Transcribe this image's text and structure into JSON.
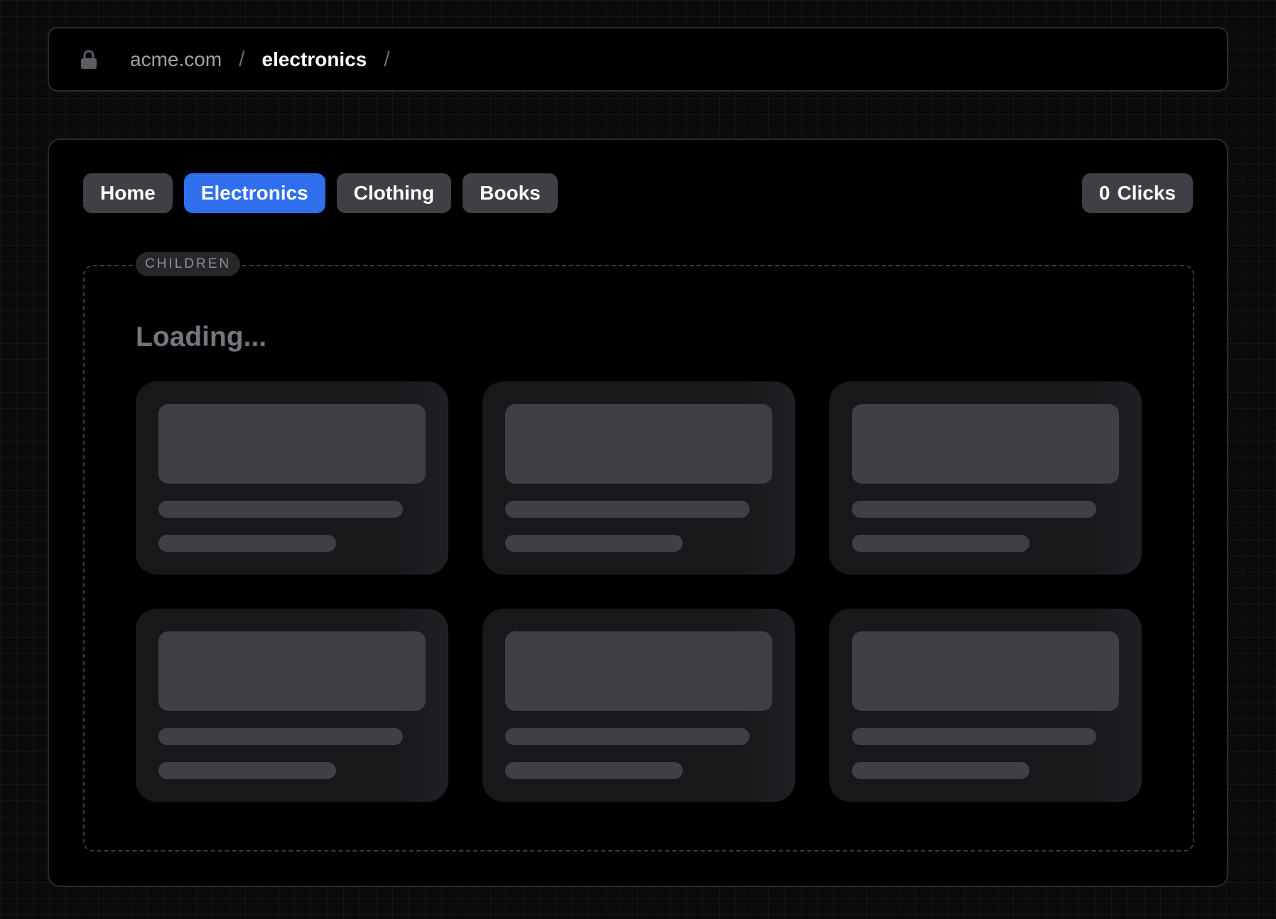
{
  "address_bar": {
    "icon": "lock-icon",
    "domain": "acme.com",
    "separator": "/",
    "segment": "electronics"
  },
  "nav": {
    "items": [
      {
        "label": "Home",
        "active": false
      },
      {
        "label": "Electronics",
        "active": true
      },
      {
        "label": "Clothing",
        "active": false
      },
      {
        "label": "Books",
        "active": false
      }
    ],
    "clicks": {
      "count": "0",
      "label": "Clicks"
    }
  },
  "children": {
    "label": "CHILDREN",
    "loading_text": "Loading..."
  },
  "colors": {
    "accent": "#2f6fed",
    "button_bg": "#3f3f46",
    "skeleton_card": "#18181b",
    "skeleton_block": "#3f3f46"
  }
}
